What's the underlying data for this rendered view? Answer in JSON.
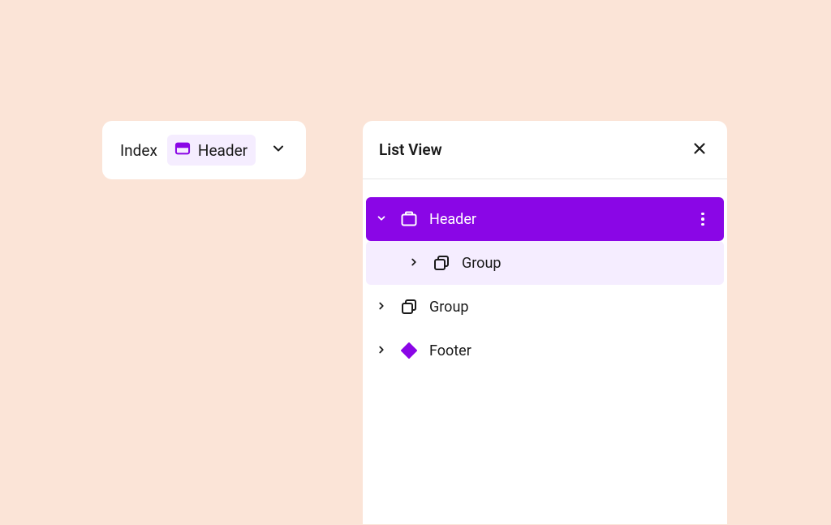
{
  "colors": {
    "accent": "#8a06e6",
    "accent_light": "#f5edff",
    "bg": "#fbe4d7"
  },
  "breadcrumb": {
    "root": "Index",
    "current": "Header"
  },
  "panel": {
    "title": "List View"
  },
  "tree": {
    "items": [
      {
        "label": "Header",
        "icon": "header-block",
        "expanded": true,
        "selected": true,
        "depth": 0
      },
      {
        "label": "Group",
        "icon": "group",
        "expanded": false,
        "selected": false,
        "hover": true,
        "depth": 1
      },
      {
        "label": "Group",
        "icon": "group",
        "expanded": false,
        "selected": false,
        "depth": 0
      },
      {
        "label": "Footer",
        "icon": "template-part",
        "expanded": false,
        "selected": false,
        "depth": 0
      }
    ]
  }
}
